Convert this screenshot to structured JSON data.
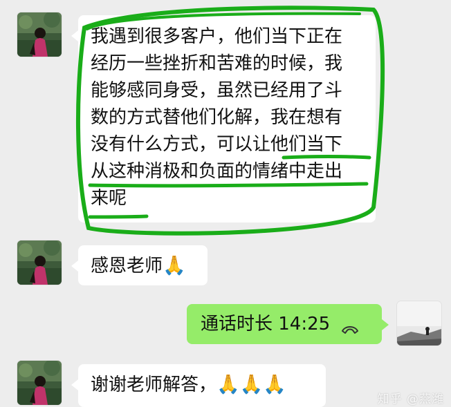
{
  "messages": [
    {
      "side": "left",
      "lines": [
        "我遇到很多客户，他们当下正在",
        "经历一些挫折和苦难的时候，我",
        "能够感同身受，虽然已经用了斗",
        "数的方式替他们化解，我在想有",
        "没有什么方式，可以让他们当下",
        "从这种消极和负面的情绪中走出",
        "来呢"
      ]
    },
    {
      "side": "left",
      "text": "感恩老师",
      "emoji": "🙏"
    },
    {
      "side": "right",
      "text": "通话时长 14:25",
      "icon": "phone-hangup-icon"
    },
    {
      "side": "left",
      "text": "谢谢老师解答，",
      "emoji": "🙏🙏🙏"
    }
  ],
  "annotation_color": "#1aad19",
  "watermark": "知乎 @燕潍"
}
